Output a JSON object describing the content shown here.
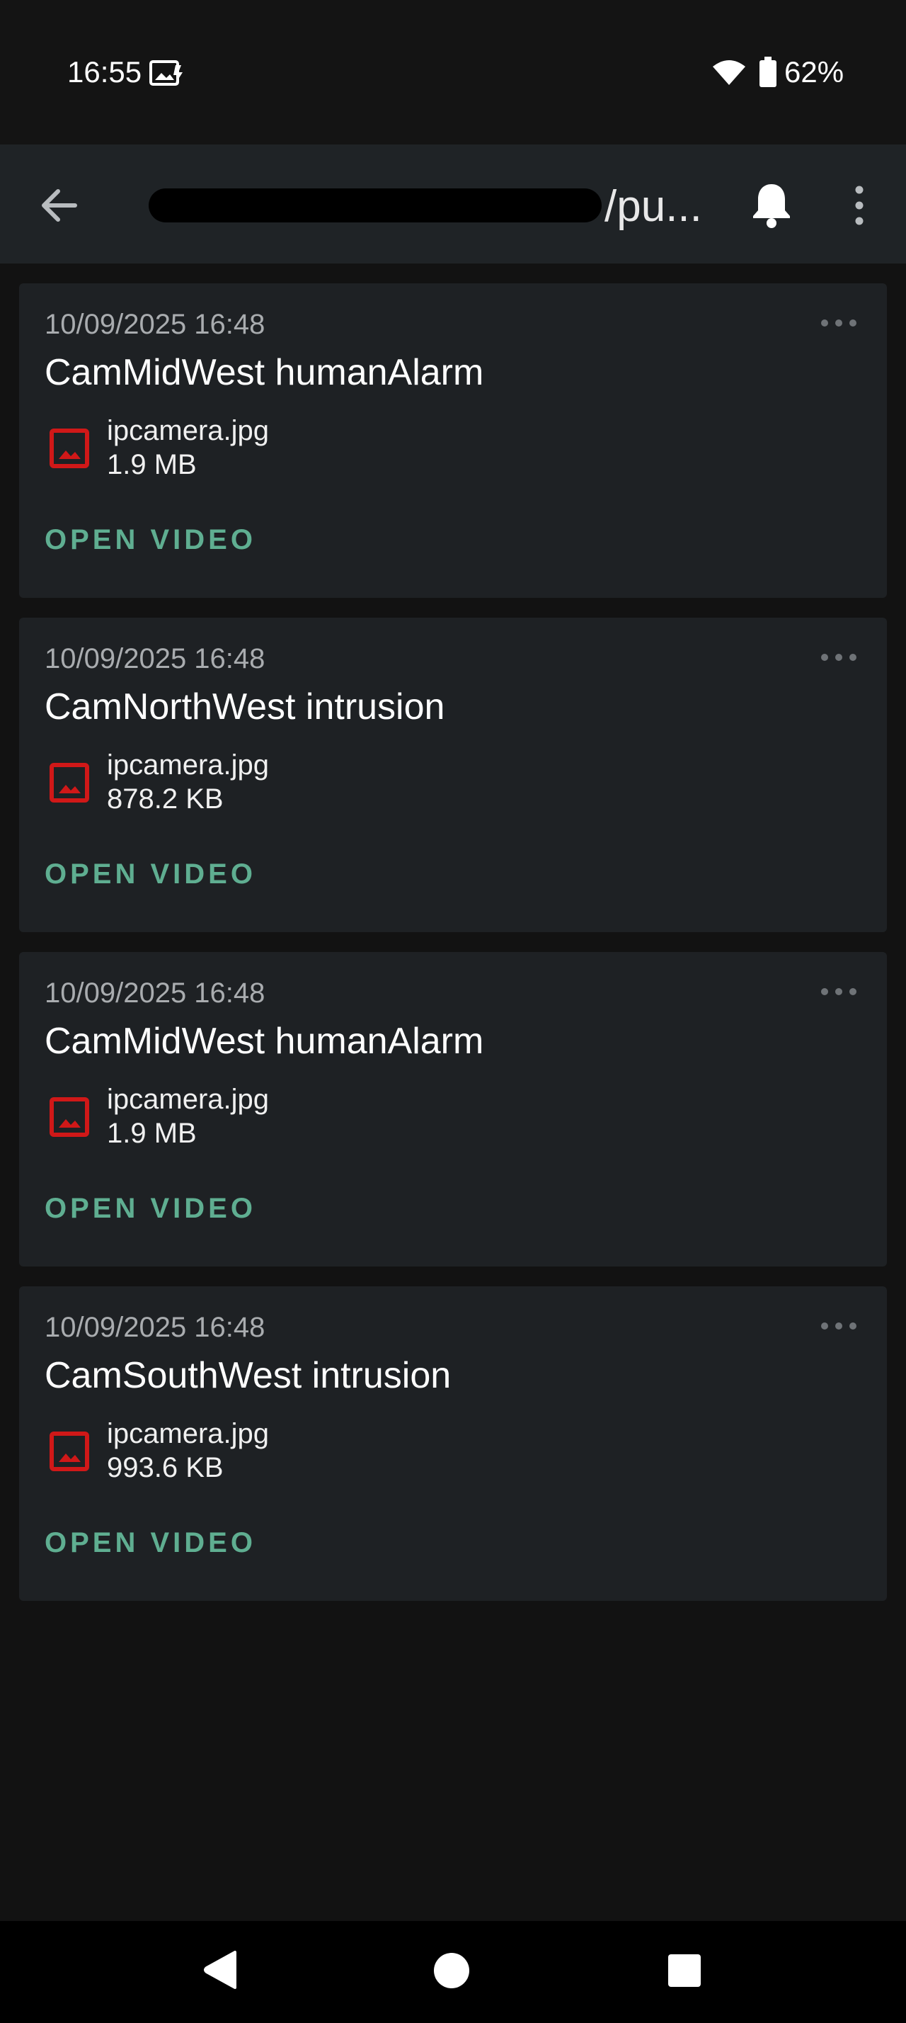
{
  "status_bar": {
    "time": "16:55",
    "battery_percent": "62%",
    "icons": [
      "image-notification-icon",
      "wifi-icon",
      "battery-icon"
    ]
  },
  "toolbar": {
    "title_visible_suffix": "/pu...",
    "title_redacted": true,
    "icons": [
      "back-arrow-icon",
      "bell-icon",
      "more-vert-icon"
    ]
  },
  "notifications": [
    {
      "date": "10/09/2025 16:48",
      "title": "CamMidWest humanAlarm",
      "attachment": {
        "name": "ipcamera.jpg",
        "size": "1.9 MB"
      },
      "action": "OPEN VIDEO"
    },
    {
      "date": "10/09/2025 16:48",
      "title": "CamNorthWest intrusion",
      "attachment": {
        "name": "ipcamera.jpg",
        "size": "878.2 KB"
      },
      "action": "OPEN VIDEO"
    },
    {
      "date": "10/09/2025 16:48",
      "title": "CamMidWest humanAlarm",
      "attachment": {
        "name": "ipcamera.jpg",
        "size": "1.9 MB"
      },
      "action": "OPEN VIDEO"
    },
    {
      "date": "10/09/2025 16:48",
      "title": "CamSouthWest intrusion",
      "attachment": {
        "name": "ipcamera.jpg",
        "size": "993.6 KB"
      },
      "action": "OPEN VIDEO"
    }
  ],
  "colors": {
    "background": "#121212",
    "card": "#1e2124",
    "toolbar": "#1f2326",
    "accent": "#5fae91",
    "attachment_icon": "#d01818"
  },
  "nav_bar": {
    "icons": [
      "nav-back-icon",
      "nav-home-icon",
      "nav-recents-icon"
    ]
  }
}
